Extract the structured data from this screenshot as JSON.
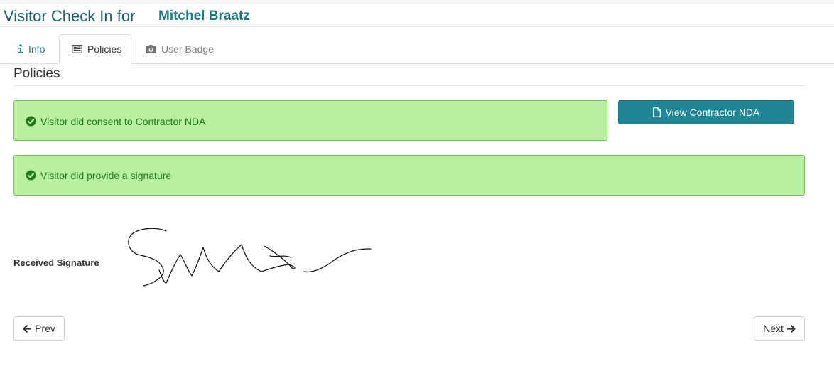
{
  "header": {
    "title": "Visitor Check In for",
    "visitor_name": "Mitchel Braatz"
  },
  "tabs": [
    {
      "label": "Info",
      "icon": "info-icon"
    },
    {
      "label": "Policies",
      "icon": "newspaper-icon",
      "active": true
    },
    {
      "label": "User Badge",
      "icon": "camera-icon"
    }
  ],
  "section": {
    "title": "Policies"
  },
  "alerts": {
    "nda": "Visitor did consent to Contractor NDA",
    "signature": "Visitor did provide a signature"
  },
  "buttons": {
    "view_nda": "View Contractor NDA",
    "prev": "Prev",
    "next": "Next"
  },
  "signature": {
    "label": "Received Signature"
  },
  "colors": {
    "accent": "#1e8694",
    "success_bg": "#b8f09e",
    "success_text": "#1f7a1a"
  }
}
